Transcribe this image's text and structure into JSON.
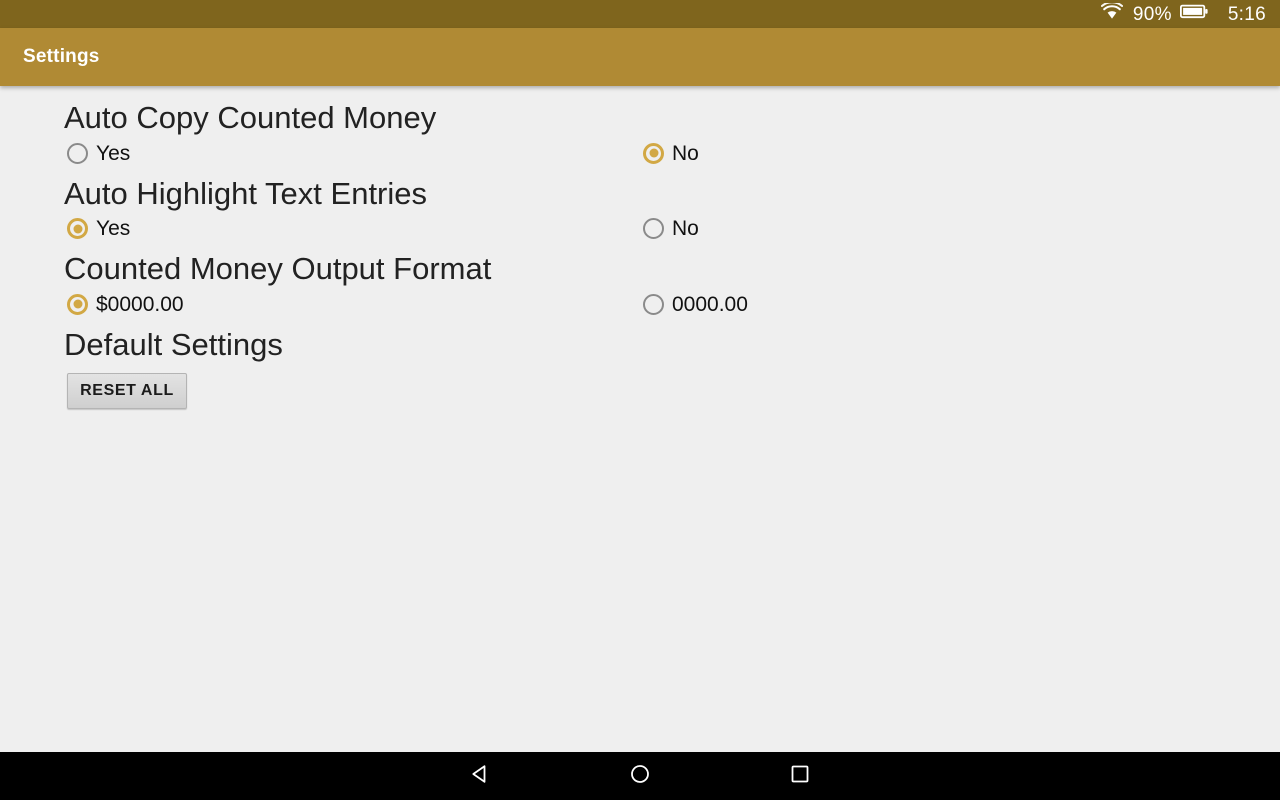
{
  "status_bar": {
    "wifi_icon": "wifi-icon",
    "battery_percent": "90%",
    "battery_icon": "battery-icon",
    "clock": "5:16",
    "background_color": "#7f651d",
    "text_color": "#ffffff"
  },
  "app_bar": {
    "title": "Settings",
    "background_color": "#b08a34",
    "title_color": "#ffffff"
  },
  "theme": {
    "accent_color": "#d2a844",
    "content_background": "#efefef",
    "unselected_radio_color": "#8a8a8a"
  },
  "settings": {
    "groups": [
      {
        "title": "Auto Copy Counted Money",
        "options": [
          {
            "label": "Yes",
            "selected": false
          },
          {
            "label": "No",
            "selected": true
          }
        ]
      },
      {
        "title": "Auto Highlight Text Entries",
        "options": [
          {
            "label": "Yes",
            "selected": true
          },
          {
            "label": "No",
            "selected": false
          }
        ]
      },
      {
        "title": "Counted Money Output Format",
        "options": [
          {
            "label": "$0000.00",
            "selected": true
          },
          {
            "label": "0000.00",
            "selected": false
          }
        ]
      }
    ],
    "default_settings": {
      "title": "Default Settings",
      "reset_button_label": "RESET ALL"
    }
  },
  "nav_bar": {
    "back_icon": "back-triangle-icon",
    "home_icon": "home-circle-icon",
    "recents_icon": "recents-square-icon",
    "background_color": "#000000"
  }
}
